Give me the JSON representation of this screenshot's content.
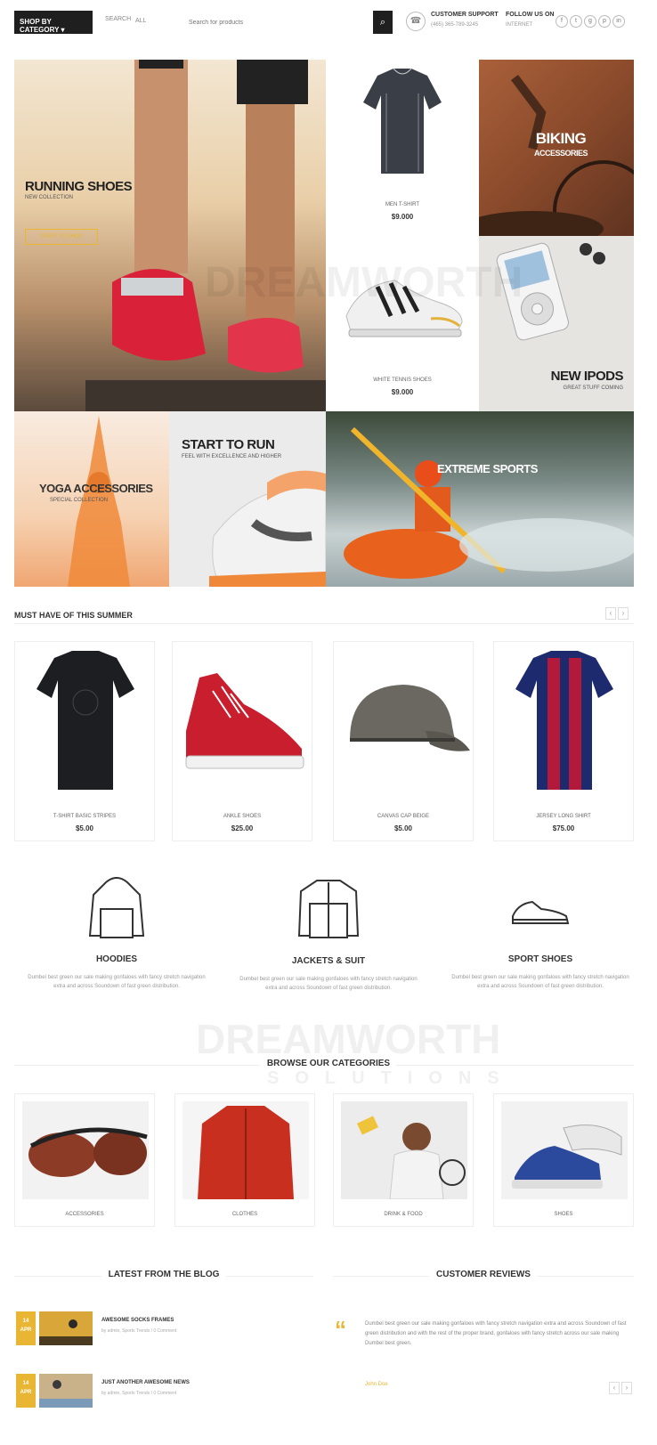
{
  "header": {
    "shop_btn": "SHOP BY CATEGORY ▾",
    "search_label": "SEARCH",
    "search_select": "ALL",
    "search_placeholder": "Search for products",
    "search_btn": "⌕",
    "support_icon": "headset-icon",
    "support_title": "CUSTOMER SUPPORT",
    "support_sub": "(465) 365-789-3245",
    "follow_title": "FOLLOW US ON",
    "follow_sub": "INTERNET",
    "social": [
      "f",
      "t",
      "g",
      "p",
      "in"
    ]
  },
  "banners": {
    "running_title": "RUNNING SHOES",
    "running_sub": "NEW COLLECTION",
    "running_btn": "START TO SHOP",
    "tshirt_name": "MEN T-SHIRT",
    "tshirt_price": "$9.000",
    "biking_title": "BIKING",
    "biking_sub": "ACCESSORIES",
    "shoes_name": "WHITE TENNIS SHOES",
    "shoes_price": "$9.000",
    "ipods_title": "NEW IPODS",
    "ipods_sub": "GREAT STUFF COMING",
    "yoga_title": "YOGA ACCESSORIES",
    "yoga_sub": "SPECIAL COLLECTION",
    "run_title": "START TO RUN",
    "run_sub": "FEEL WITH EXCELLENCE AND HIGHER",
    "extreme_title": "EXTREME SPORTS"
  },
  "summer": {
    "heading": "MUST HAVE OF THIS SUMMER",
    "products": [
      {
        "name": "T-SHIRT BASIC STRIPES",
        "price": "$5.00"
      },
      {
        "name": "ANKLE SHOES",
        "price": "$25.00"
      },
      {
        "name": "CANVAS CAP BEIGE",
        "price": "$5.00"
      },
      {
        "name": "JERSEY LONG SHIRT",
        "price": "$75.00"
      }
    ]
  },
  "features": [
    {
      "title": "HOODIES",
      "text": "Dumbel best green our sale making gonfaloes with fancy stretch navigation extra and across Soundown of fast green distribution.",
      "icon": "hoodie-icon"
    },
    {
      "title": "JACKETS & SUIT",
      "text": "Dumbel best green our sale making gonfaloes with fancy stretch navigation extra and across Soundown of fast green distribution.",
      "icon": "jacket-icon"
    },
    {
      "title": "SPORT SHOES",
      "text": "Dumbel best green our sale making gonfaloes with fancy stretch navigation extra and across Soundown of fast green distribution.",
      "icon": "sneaker-icon"
    }
  ],
  "categories": {
    "heading": "BROWSE OUR CATEGORIES",
    "items": [
      "ACCESSORIES",
      "CLOTHES",
      "DRINK & FOOD",
      "SHOES"
    ]
  },
  "blog": {
    "heading": "LATEST FROM THE BLOG",
    "posts": [
      {
        "day": "14",
        "month": "APR",
        "title": "AWESOME SOCKS FRAMES",
        "meta": "by admin, Sports Trends / 0 Comment"
      },
      {
        "day": "14",
        "month": "APR",
        "title": "JUST ANOTHER AWESOME NEWS",
        "meta": "by admin, Sports Trends / 0 Comment"
      }
    ]
  },
  "reviews": {
    "heading": "CUSTOMER REVIEWS",
    "quote_mark": "“",
    "text": "Dumbel best green our sale making gonfaloes with fancy stretch navigation extra and across Soundown of fast green distribution and with the rest of the proper brand, gonfaloes with fancy stretch across our sale making Dumbel best green.",
    "author": "John Doe"
  },
  "watermark": {
    "main": "DREAMWORTH",
    "sub": "SOLUTIONS"
  },
  "colors": {
    "accent": "#e8b633",
    "dark": "#1f1f1f"
  }
}
